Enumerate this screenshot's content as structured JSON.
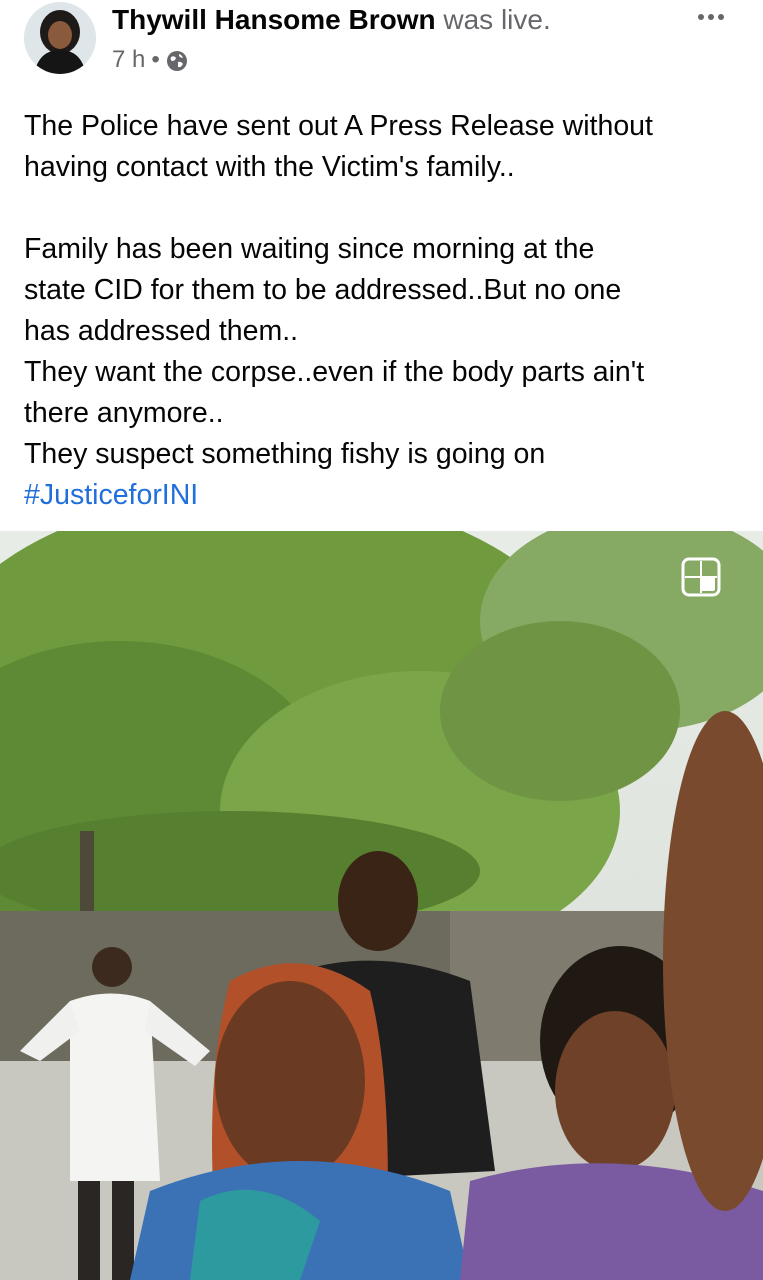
{
  "post": {
    "author_name": "Thywill Hansome Brown",
    "author_suffix": "was live.",
    "time": "7 h",
    "separator": "•",
    "privacy_icon": "globe-icon",
    "more_icon": "more-options-icon"
  },
  "body": {
    "paragraph1_line1": "The Police have sent out A Press Release without",
    "paragraph1_line2": "having contact with the Victim's family..",
    "paragraph2_line1": "Family has been waiting since morning at the",
    "paragraph2_line2": "state CID for them to be addressed..But no one",
    "paragraph2_line3": "has addressed them..",
    "paragraph2_line4": "They want the corpse..even if the body parts ain't",
    "paragraph2_line5": "there anymore..",
    "paragraph2_line6": "They suspect something fishy is going on",
    "hashtag": "#JusticeforINI"
  },
  "video": {
    "overlay_icon": "picture-in-picture-icon"
  },
  "colors": {
    "hashtag": "#216fdb",
    "secondary_text": "#65676b",
    "primary_text": "#050505"
  }
}
